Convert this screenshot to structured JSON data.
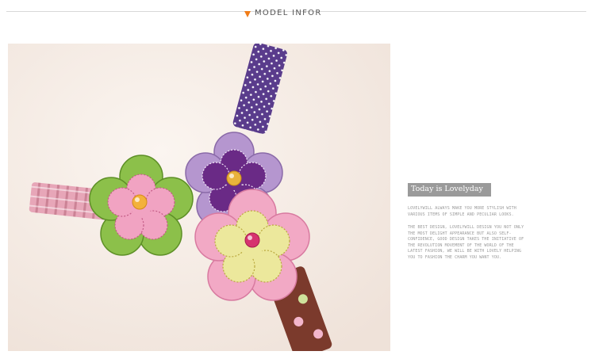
{
  "header": {
    "title": "MODEL INFOR",
    "arrow_color": "#f07c18"
  },
  "product_image": {
    "alt": "Three felt flower hair clips: a purple flower on a purple polka-dot ribbon, a pink and green flower on a pink plaid ribbon, and a pink and yellow flower on a brown polka-dot ribbon",
    "colors": {
      "background": "#f5ece6",
      "purple": "#6a2a86",
      "lilac": "#b596cf",
      "pink": "#f1a3c2",
      "green": "#8cc04a",
      "yellow": "#ece89c",
      "brown": "#7b3a2c"
    }
  },
  "side_text": {
    "tagline": "Today is Lovelyday",
    "paragraph_1": "LOVELYWILL ALWAYS MAKE YOU MORE STYLISH WITH VARIOUS ITEMS OF SIMPLE AND PECULIAR LOOKS.",
    "paragraph_2": "THE BEST DESIGN, LOVELYWILL DESIGN YOU NOT ONLY THE MOST DELIGHT APPEARANCE BUT ALSO SELF-CONFIDENCE, GOOD DESIGN TAKES THE INITIATIVE OF THE REVOLUTION MOVEMENT OF THE WORLD OF THE LATEST FASHION, WE WILL BE WITH LOVELY HELPING YOU TO FASHION THE CHARM YOU WANT YOU."
  }
}
